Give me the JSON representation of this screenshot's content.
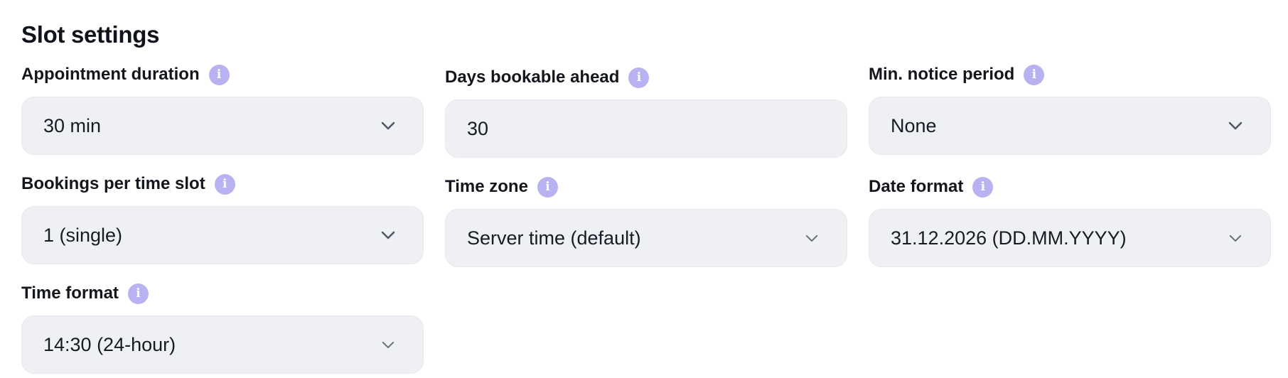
{
  "section": {
    "title": "Slot settings"
  },
  "fields": {
    "appointment_duration": {
      "label": "Appointment duration",
      "value": "30 min",
      "type": "select",
      "icon": "chevron-down-icon"
    },
    "days_bookable_ahead": {
      "label": "Days bookable ahead",
      "value": "30",
      "type": "number-input"
    },
    "min_notice_period": {
      "label": "Min. notice period",
      "value": "None",
      "type": "select",
      "icon": "chevron-down-icon"
    },
    "bookings_per_time_slot": {
      "label": "Bookings per time slot",
      "value": "1 (single)",
      "type": "select",
      "icon": "chevron-down-icon"
    },
    "time_zone": {
      "label": "Time zone",
      "value": "Server time (default)",
      "type": "select",
      "icon": "chevron-down-icon"
    },
    "date_format": {
      "label": "Date format",
      "value": "31.12.2026 (DD.MM.YYYY)",
      "type": "select",
      "icon": "chevron-down-icon"
    },
    "time_format": {
      "label": "Time format",
      "value": "14:30 (24-hour)",
      "type": "select",
      "icon": "chevron-down-icon"
    }
  },
  "info_icon": {
    "glyph": "i",
    "name": "info-icon",
    "color": "#b8b2f0"
  },
  "colors": {
    "control_background": "#eff0f4",
    "text": "#14161d",
    "chevron": "#545866"
  }
}
